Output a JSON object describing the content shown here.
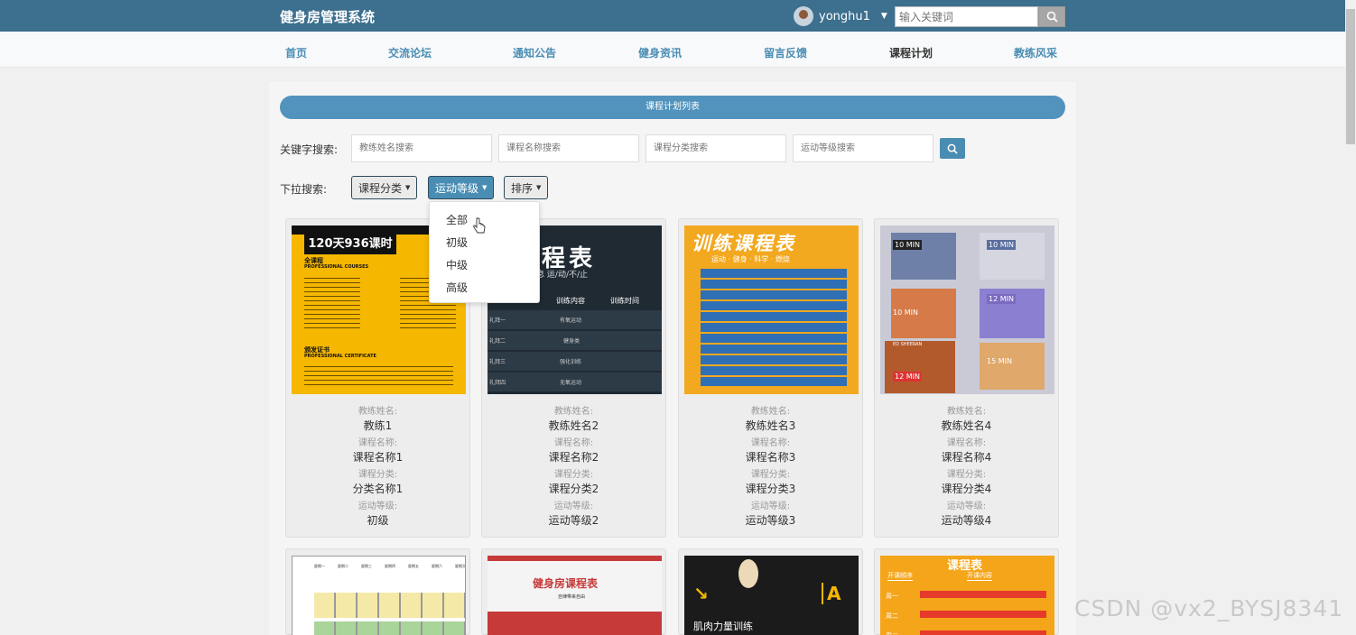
{
  "header": {
    "brand": "健身房管理系统",
    "username": "yonghu1",
    "search_placeholder": "输入关键词"
  },
  "nav": {
    "items": [
      "首页",
      "交流论坛",
      "通知公告",
      "健身资讯",
      "留言反馈",
      "课程计划",
      "教练风采"
    ],
    "active": "课程计划"
  },
  "list_title": "课程计划列表",
  "keyword_search": {
    "label": "关键字搜索:",
    "placeholders": [
      "教练姓名搜索",
      "课程名称搜索",
      "课程分类搜索",
      "运动等级搜索"
    ]
  },
  "dropdown_search": {
    "label": "下拉搜索:",
    "buttons": [
      "课程分类",
      "运动等级",
      "排序"
    ],
    "open_menu_options": [
      "全部",
      "初级",
      "中级",
      "高级"
    ]
  },
  "field_labels": {
    "coach": "教练姓名:",
    "course": "课程名称:",
    "category": "课程分类:",
    "level": "运动等级:"
  },
  "cards": [
    {
      "coach": "教练1",
      "course": "课程名称1",
      "category": "分类名称1",
      "level": "初级",
      "image": {
        "title": "120天936课时",
        "sub1": "全课程",
        "sub2": "PROFESSIONAL COURSES",
        "sub3": "颁发证书",
        "sub4": "PROFESSIONAL CERTIFICATE"
      }
    },
    {
      "coach": "教练姓名2",
      "course": "课程名称2",
      "category": "课程分类2",
      "level": "运动等级2",
      "image": {
        "title": "课程表",
        "subtitle": "命/不/息 运/动/不/止",
        "col1": "训练内容",
        "col2": "训练时间",
        "rows": [
          [
            "礼拜一",
            "有氧运动",
            "AM10:00-12:00 PM14:00-16:00"
          ],
          [
            "礼拜二",
            "健身类",
            "AM10:00-12:00 PM14:00-16:00"
          ],
          [
            "礼拜三",
            "强化训练",
            "AM10:00-12:00 PM14:00-16:00"
          ],
          [
            "礼拜四",
            "无氧运动",
            "AM10:00-12:00 PM14:00-16:00"
          ]
        ]
      }
    },
    {
      "coach": "教练姓名3",
      "course": "课程名称3",
      "category": "课程分类3",
      "level": "运动等级3",
      "image": {
        "title": "训练课程表",
        "subtitle": "运动 · 健身 · 科学 · 燃烧"
      }
    },
    {
      "coach": "教练姓名4",
      "course": "课程名称4",
      "category": "课程分类4",
      "level": "运动等级4",
      "image": {
        "tags": [
          "10 MIN",
          "10 MIN",
          "10 MIN",
          "12 MIN",
          "12 MIN",
          "15 MIN"
        ],
        "caption": "ED SHEERAN"
      }
    }
  ],
  "row2_cards": [
    {
      "image": {
        "headers": [
          "星期一",
          "星期二",
          "星期三",
          "星期四",
          "星期五",
          "星期六",
          "星期天"
        ]
      }
    },
    {
      "image": {
        "title": "健身房课程表",
        "sub": "自律带来自由"
      }
    },
    {
      "image": {
        "title": "肌肉力量训练"
      }
    },
    {
      "image": {
        "title": "课程表",
        "col1": "开课顺序",
        "col2": "开课内容",
        "rows": [
          "周一",
          "周二",
          "周三"
        ]
      }
    }
  ],
  "watermark": "CSDN @vx2_BYSJ8341",
  "colors": {
    "topbar": "#3d6f8e",
    "accent": "#4a8db3",
    "title_bar": "#5193bd"
  }
}
